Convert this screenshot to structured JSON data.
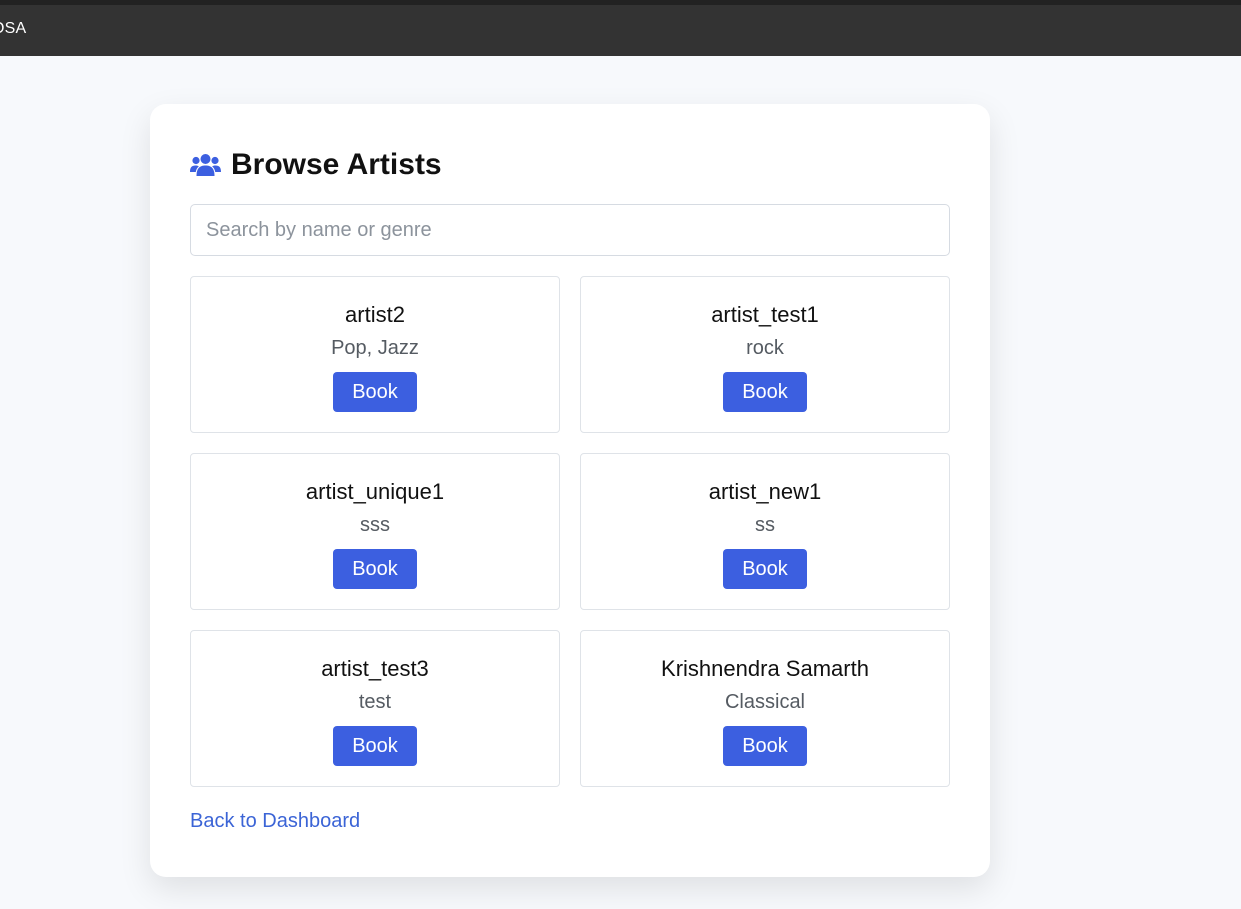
{
  "navbar": {
    "brand": "OSA"
  },
  "page": {
    "title": "Browse Artists",
    "title_icon": "users-icon",
    "accent_color": "#3c5fe0"
  },
  "search": {
    "placeholder": "Search by name or genre",
    "value": ""
  },
  "artists": [
    {
      "name": "artist2",
      "genre": "Pop, Jazz",
      "button_label": "Book"
    },
    {
      "name": "artist_test1",
      "genre": "rock",
      "button_label": "Book"
    },
    {
      "name": "artist_unique1",
      "genre": "sss",
      "button_label": "Book"
    },
    {
      "name": "artist_new1",
      "genre": "ss",
      "button_label": "Book"
    },
    {
      "name": "artist_test3",
      "genre": "test",
      "button_label": "Book"
    },
    {
      "name": "Krishnendra Samarth",
      "genre": "Classical",
      "button_label": "Book"
    }
  ],
  "footer": {
    "back_link": "Back to Dashboard"
  }
}
